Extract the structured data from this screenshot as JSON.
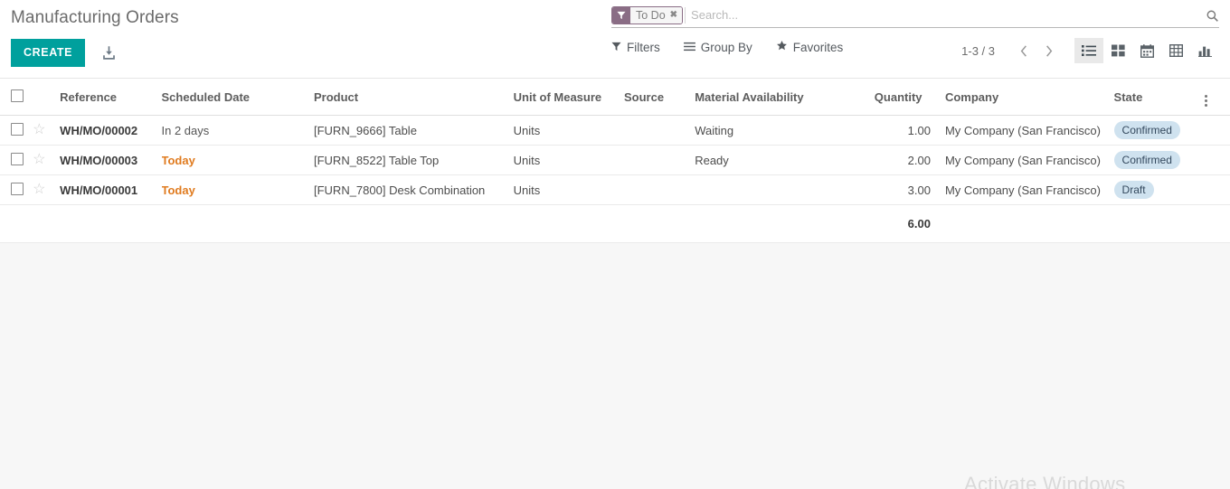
{
  "header": {
    "title": "Manufacturing Orders",
    "create_label": "CREATE",
    "import_icon": "import-download-icon"
  },
  "search": {
    "placeholder": "Search...",
    "value": "",
    "facet": {
      "label": "To Do",
      "icon": "filter-funnel-icon",
      "remove": "✖"
    },
    "search_icon": "search-icon"
  },
  "filter_bar": {
    "filters_label": "Filters",
    "group_by_label": "Group By",
    "favorites_label": "Favorites"
  },
  "pager": {
    "count": "1-3 / 3",
    "prev_icon": "chevron-left-icon",
    "next_icon": "chevron-right-icon"
  },
  "views": [
    {
      "name": "list",
      "icon": "list-view-icon",
      "active": true
    },
    {
      "name": "kanban",
      "icon": "kanban-view-icon",
      "active": false
    },
    {
      "name": "calendar",
      "icon": "calendar-view-icon",
      "active": false
    },
    {
      "name": "pivot",
      "icon": "pivot-view-icon",
      "active": false
    },
    {
      "name": "graph",
      "icon": "graph-view-icon",
      "active": false
    }
  ],
  "table": {
    "columns": [
      "Reference",
      "Scheduled Date",
      "Product",
      "Unit of Measure",
      "Source",
      "Material Availability",
      "Quantity",
      "Company",
      "State"
    ],
    "rows": [
      {
        "reference": "WH/MO/00002",
        "scheduled_date": "In 2 days",
        "date_urgent": false,
        "product": "[FURN_9666] Table",
        "uom": "Units",
        "source": "",
        "material_availability": "Waiting",
        "quantity": "1.00",
        "company": "My Company (San Francisco)",
        "state": "Confirmed"
      },
      {
        "reference": "WH/MO/00003",
        "scheduled_date": "Today",
        "date_urgent": true,
        "product": "[FURN_8522] Table Top",
        "uom": "Units",
        "source": "",
        "material_availability": "Ready",
        "quantity": "2.00",
        "company": "My Company (San Francisco)",
        "state": "Confirmed"
      },
      {
        "reference": "WH/MO/00001",
        "scheduled_date": "Today",
        "date_urgent": true,
        "product": "[FURN_7800] Desk Combination",
        "uom": "Units",
        "source": "",
        "material_availability": "",
        "quantity": "3.00",
        "company": "My Company (San Francisco)",
        "state": "Draft"
      }
    ],
    "total_quantity": "6.00"
  },
  "watermark": {
    "text": "Activate Windows"
  },
  "colors": {
    "accent": "#00a09d",
    "facet": "#8a6d85",
    "badge_bg": "#cfe2ef",
    "urgent_date": "#e07b1f"
  }
}
